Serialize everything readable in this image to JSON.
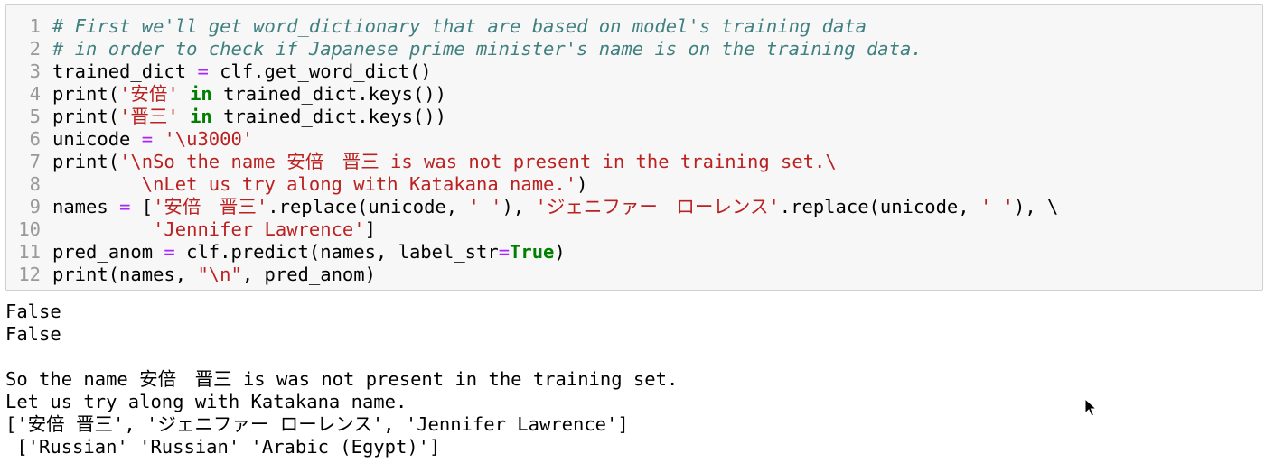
{
  "cell": {
    "line_numbers": [
      "1",
      "2",
      "3",
      "4",
      "5",
      "6",
      "7",
      "8",
      "9",
      "10",
      "11",
      "12"
    ],
    "lines": [
      [
        {
          "t": "# First we'll get word_dictionary that are based on model's training data",
          "c": "cm"
        }
      ],
      [
        {
          "t": "# in order to check if Japanese prime minister's name is on the training data.",
          "c": "cm"
        }
      ],
      [
        {
          "t": "trained_dict ",
          "c": ""
        },
        {
          "t": "=",
          "c": "op"
        },
        {
          "t": " clf.get_word_dict()",
          "c": ""
        }
      ],
      [
        {
          "t": "print(",
          "c": ""
        },
        {
          "t": "'安倍'",
          "c": "st"
        },
        {
          "t": " ",
          "c": ""
        },
        {
          "t": "in",
          "c": "kw"
        },
        {
          "t": " trained_dict.keys())",
          "c": ""
        }
      ],
      [
        {
          "t": "print(",
          "c": ""
        },
        {
          "t": "'晋三'",
          "c": "st"
        },
        {
          "t": " ",
          "c": ""
        },
        {
          "t": "in",
          "c": "kw"
        },
        {
          "t": " trained_dict.keys())",
          "c": ""
        }
      ],
      [
        {
          "t": "unicode ",
          "c": ""
        },
        {
          "t": "=",
          "c": "op"
        },
        {
          "t": " ",
          "c": ""
        },
        {
          "t": "'\\u3000'",
          "c": "st"
        }
      ],
      [
        {
          "t": "print(",
          "c": ""
        },
        {
          "t": "'\\nSo the name 安倍　晋三 is was not present in the training set.\\",
          "c": "st"
        }
      ],
      [
        {
          "t": "        \\nLet us try along with Katakana name.'",
          "c": "st"
        },
        {
          "t": ")",
          "c": ""
        }
      ],
      [
        {
          "t": "names ",
          "c": ""
        },
        {
          "t": "=",
          "c": "op"
        },
        {
          "t": " [",
          "c": ""
        },
        {
          "t": "'安倍　晋三'",
          "c": "st"
        },
        {
          "t": ".replace(unicode, ",
          "c": ""
        },
        {
          "t": "' '",
          "c": "st"
        },
        {
          "t": "), ",
          "c": ""
        },
        {
          "t": "'ジェニファー　ローレンス'",
          "c": "st"
        },
        {
          "t": ".replace(unicode, ",
          "c": ""
        },
        {
          "t": "' '",
          "c": "st"
        },
        {
          "t": "), \\",
          "c": ""
        }
      ],
      [
        {
          "t": "         ",
          "c": ""
        },
        {
          "t": "'Jennifer Lawrence'",
          "c": "st"
        },
        {
          "t": "]",
          "c": ""
        }
      ],
      [
        {
          "t": "pred_anom ",
          "c": ""
        },
        {
          "t": "=",
          "c": "op"
        },
        {
          "t": " clf.predict(names, label_str",
          "c": ""
        },
        {
          "t": "=",
          "c": "op"
        },
        {
          "t": "True",
          "c": "kw"
        },
        {
          "t": ")",
          "c": ""
        }
      ],
      [
        {
          "t": "print(names, ",
          "c": ""
        },
        {
          "t": "\"\\n\"",
          "c": "st"
        },
        {
          "t": ", pred_anom)",
          "c": ""
        }
      ]
    ]
  },
  "output": {
    "lines": [
      "False",
      "False",
      "",
      "So the name 安倍　晋三 is was not present in the training set.",
      "Let us try along with Katakana name.",
      "['安倍 晋三', 'ジェニファー ローレンス', 'Jennifer Lawrence']",
      " ['Russian' 'Russian' 'Arabic (Egypt)']"
    ]
  },
  "icons": {
    "cursor": "mouse-pointer-icon"
  }
}
